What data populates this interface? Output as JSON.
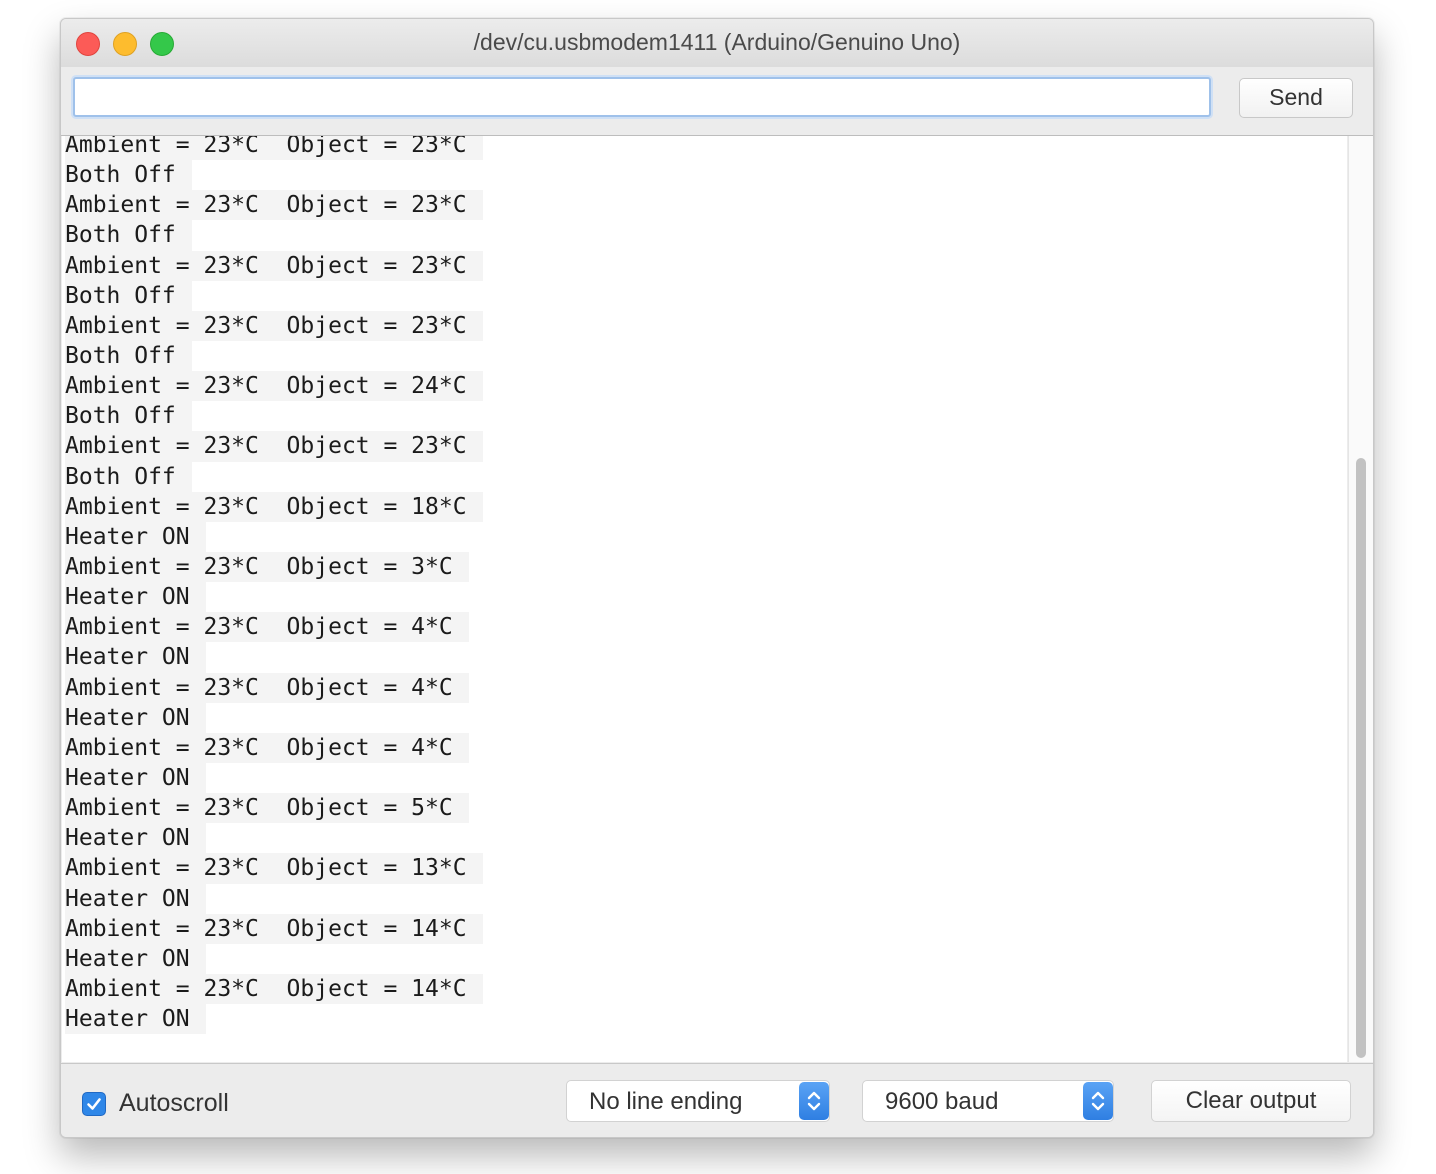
{
  "window": {
    "title": "/dev/cu.usbmodem1411 (Arduino/Genuino Uno)"
  },
  "toolbar": {
    "input_value": "",
    "send_label": "Send"
  },
  "output": {
    "lines": [
      "Ambient = 23*C  Object = 23*C",
      "Both Off",
      "Ambient = 23*C  Object = 23*C",
      "Both Off",
      "Ambient = 23*C  Object = 23*C",
      "Both Off",
      "Ambient = 23*C  Object = 23*C",
      "Both Off",
      "Ambient = 23*C  Object = 24*C",
      "Both Off",
      "Ambient = 23*C  Object = 23*C",
      "Both Off",
      "Ambient = 23*C  Object = 18*C",
      "Heater ON",
      "Ambient = 23*C  Object = 3*C",
      "Heater ON",
      "Ambient = 23*C  Object = 4*C",
      "Heater ON",
      "Ambient = 23*C  Object = 4*C",
      "Heater ON",
      "Ambient = 23*C  Object = 4*C",
      "Heater ON",
      "Ambient = 23*C  Object = 5*C",
      "Heater ON",
      "Ambient = 23*C  Object = 13*C",
      "Heater ON",
      "Ambient = 23*C  Object = 14*C",
      "Heater ON",
      "Ambient = 23*C  Object = 14*C",
      "Heater ON"
    ]
  },
  "statusbar": {
    "autoscroll_label": "Autoscroll",
    "autoscroll_checked": true,
    "line_ending": "No line ending",
    "baud": "9600 baud",
    "clear_label": "Clear output"
  },
  "colors": {
    "accent": "#2f87e8",
    "close": "#fc5b57",
    "minimize": "#fdbc2e",
    "maximize": "#34c84a"
  },
  "icons": {
    "close": "close-window-icon",
    "minimize": "minimize-window-icon",
    "maximize": "maximize-window-icon",
    "checkbox": "checkmark-icon",
    "stepper": "up-down-chevron-icon"
  }
}
